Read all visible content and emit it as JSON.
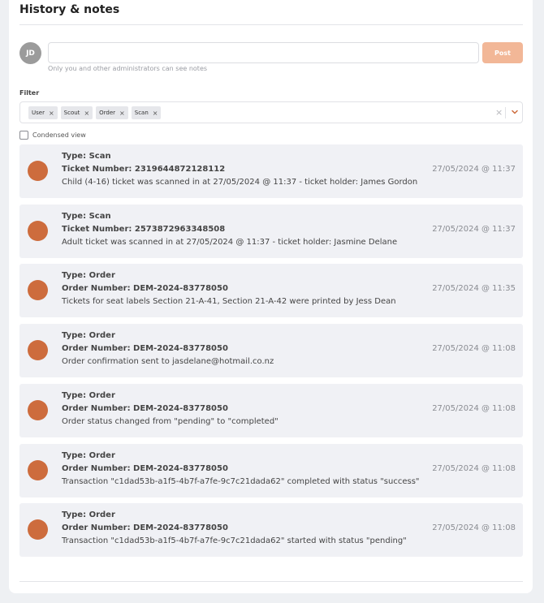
{
  "section": {
    "title": "History & notes"
  },
  "composer": {
    "avatar_initials": "JD",
    "input_value": "",
    "input_placeholder": "",
    "post_label": "Post",
    "hint": "Only you and other administrators can see notes"
  },
  "filter": {
    "label": "Filter",
    "chips": [
      "User",
      "Scout",
      "Order",
      "Scan"
    ],
    "clear_glyph": "×"
  },
  "condensed_label": "Condensed view",
  "colors": {
    "accent": "#cd6c3d",
    "post_button": "#f2b797",
    "entry_bg": "#f0f1f5"
  },
  "entries": [
    {
      "type": "Type: Scan",
      "number": "Ticket Number: 2319644872128112",
      "message": "Child (4-16) ticket was scanned in at 27/05/2024 @ 11:37 - ticket holder: James Gordon",
      "time": "27/05/2024 @ 11:37"
    },
    {
      "type": "Type: Scan",
      "number": "Ticket Number: 2573872963348508",
      "message": "Adult ticket was scanned in at 27/05/2024 @ 11:37 - ticket holder: Jasmine Delane",
      "time": "27/05/2024 @ 11:37"
    },
    {
      "type": "Type: Order",
      "number": "Order Number: DEM-2024-83778050",
      "message": "Tickets for seat labels Section 21-A-41, Section 21-A-42 were printed by Jess Dean",
      "time": "27/05/2024 @ 11:35"
    },
    {
      "type": "Type: Order",
      "number": "Order Number: DEM-2024-83778050",
      "message": "Order confirmation sent to jasdelane@hotmail.co.nz",
      "time": "27/05/2024 @ 11:08"
    },
    {
      "type": "Type: Order",
      "number": "Order Number: DEM-2024-83778050",
      "message": "Order status changed from \"pending\" to \"completed\"",
      "time": "27/05/2024 @ 11:08"
    },
    {
      "type": "Type: Order",
      "number": "Order Number: DEM-2024-83778050",
      "message": "Transaction \"c1dad53b-a1f5-4b7f-a7fe-9c7c21dada62\" completed with status \"success\"",
      "time": "27/05/2024 @ 11:08"
    },
    {
      "type": "Type: Order",
      "number": "Order Number: DEM-2024-83778050",
      "message": "Transaction \"c1dad53b-a1f5-4b7f-a7fe-9c7c21dada62\" started with status \"pending\"",
      "time": "27/05/2024 @ 11:08"
    }
  ]
}
